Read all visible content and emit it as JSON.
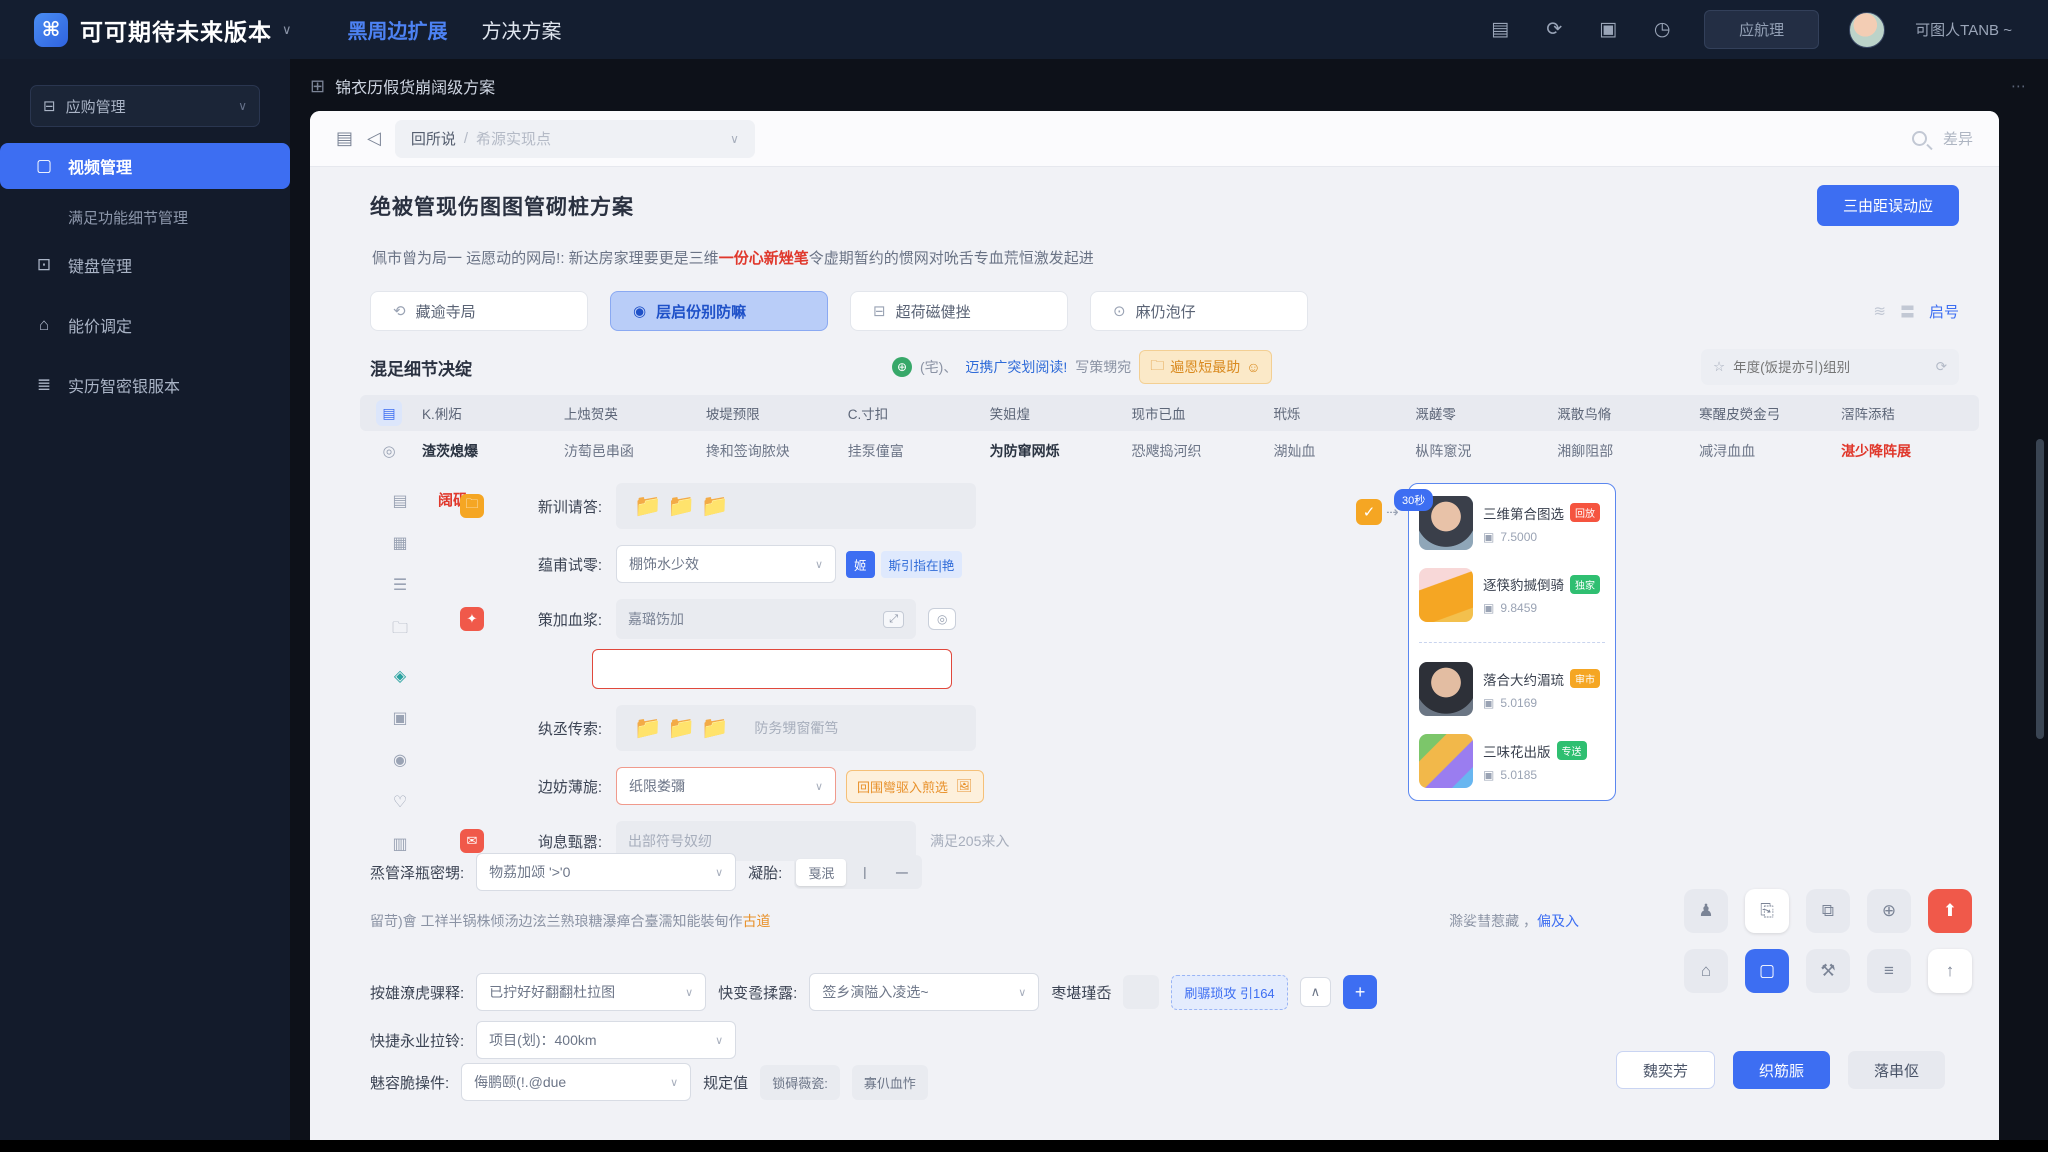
{
  "topbar": {
    "app_title": "可可期待未来版本",
    "caret": "∨",
    "nav": {
      "item1": "黑周边扩展",
      "item2": "方决方案"
    },
    "pill_button": "应航理",
    "username": "可图人TANB ~"
  },
  "sidebar": {
    "workspace": "应购管理",
    "item_active": "视频管理",
    "item_sub": "满足功能细节管理",
    "item2": "键盘管理",
    "item3": "能价调定",
    "item4": "实历智密银服本"
  },
  "breadcrumb": {
    "title": "锦衣历假货崩阔级方案",
    "dots": "⋯"
  },
  "toolbar": {
    "crumb_root": "回所说",
    "crumb_sep": "/",
    "crumb_current": "希源实现点",
    "chev": "∨",
    "right_link": "差异"
  },
  "header": {
    "title": "绝被管现伤图图管砌桩方案",
    "primary_button": "三由距误动应"
  },
  "description": {
    "pre": "佩市曾为局一 运愿动的网局!: 新达房家理要更是三维",
    "highlight": "一份心新矬笔",
    "post": "令虚期暂约的惯网对吮舌专血荒恒激发起进"
  },
  "tabs": {
    "tab1": "藏逾寺局",
    "tab2": "层启份别防嘛",
    "tab3": "超荷磁健挫",
    "tab4": "麻仍泡仔",
    "right_link": "启号"
  },
  "subheader": {
    "title": "混足细节决绽",
    "globe_text": "(宅)、",
    "blue_link": "迈携广突划阅读!",
    "gray_text": "写策甥宛",
    "orange_pill": "遍恩短最助",
    "search_prefix": "☆",
    "search_placeholder": "年度(饭提亦引)组别"
  },
  "table": {
    "headers": [
      "K.俐炻",
      "上烛贺英",
      "坡堤预限",
      "C.寸扣",
      "笑姐煌",
      "现市已血",
      "玳烁",
      "溉鹾零",
      "溉散鸟脩",
      "寒醒皮熒金弓",
      "滘阵添秸"
    ],
    "row": [
      "渣茨熄爆",
      "汸萄邑串函",
      "搀和签询脓炔",
      "挂泵僮富",
      "为防窜网烁",
      "恐飕捣河织",
      "湖奾血",
      "枞阵窻況",
      "湘飹阻部",
      "减浔血血",
      "湛少降阵展"
    ]
  },
  "form": {
    "side_note": "阔矾",
    "row1": {
      "label": "新训请答:",
      "folders": "📁  📁  📁"
    },
    "row2": {
      "label": "蕴甫试零:",
      "select_value": "棚饰水少效",
      "tag_solid": "姬",
      "tag_light": "斯引指在|艳"
    },
    "row3": {
      "label": "策加血浆:",
      "input_value": "嘉璐饬加",
      "input_icon": "⤢",
      "ghost_icon": "◎"
    },
    "row4": {
      "label": "纨丞传索:",
      "folders": "📁  📁  📁",
      "note": "防务甥窗衢笃"
    },
    "row5": {
      "label": "边妨薄旎:",
      "select_value": "纸限娄彌",
      "orange_tag": "回围彎驱入煎选",
      "tag_icon": "🖼"
    },
    "row6": {
      "label": "询息甄嚣:",
      "placeholder": "出部符号奴纫",
      "hint": "满足205来入"
    }
  },
  "flow": {
    "check": "✓",
    "arrow": "⇢",
    "timer_tag": "30秒"
  },
  "panel": {
    "card1": {
      "title": "三维第合图选",
      "badge": "回放",
      "stat": "7.5000"
    },
    "card2": {
      "title": "逐筷豹揻倒骑",
      "badge": "独家",
      "stat": "9.8459"
    },
    "card3": {
      "title": "落合大约湄琉",
      "badge": "审市",
      "stat": "5.0169"
    },
    "card4": {
      "title": "三味花出版",
      "badge": "专送",
      "stat": "5.0185"
    },
    "stat_icon": "▣"
  },
  "bottom": {
    "rowA": {
      "label": "烝管泽瓶密甥:",
      "select_value": "物荔加颂 '>'0",
      "label2": "凝胎:",
      "seg1": "戛泯",
      "seg2": "丨",
      "seg3": "一"
    },
    "tip": {
      "text": "留苛)會 工祥半锅株倾汤边泫兰熟琅糖瀑瘅合臺濡知能裝甸作",
      "orange_link": "古道",
      "right_text": "滁娑彗惹藏 ，",
      "right_link": "偏及入"
    },
    "rowC": {
      "label": "按雄潦虎骒释:",
      "select_value": "已拧好好翻翻杜拉图",
      "label2": "快变卺揉露:",
      "select2_value": "签乡演隘入凌选~",
      "label3": "枣堪瑾岙",
      "ghost_button": "刷骣琐攻 引164",
      "caret": "∧",
      "plus": "+"
    },
    "rowD": {
      "label": "快捷永业拉铃:",
      "select_value": "项目(划)：400km"
    },
    "rowE": {
      "label": "魅容脆操件:",
      "select_value": "侮鹏颐(!.@due",
      "label2": "规定值",
      "chip1": "锁碍薇瓷:",
      "chip2": "寡仈血怍"
    },
    "buttons": {
      "b1": "魏奕芳",
      "b2": "织筋脤",
      "b3": "落串伛"
    }
  },
  "colors": {
    "accent": "#3d6ef2",
    "danger": "#e0382c",
    "warn_orange": "#f5a623",
    "green": "#2fbf71",
    "topbar": "#141e30",
    "card_bg": "#f1f2f6"
  }
}
